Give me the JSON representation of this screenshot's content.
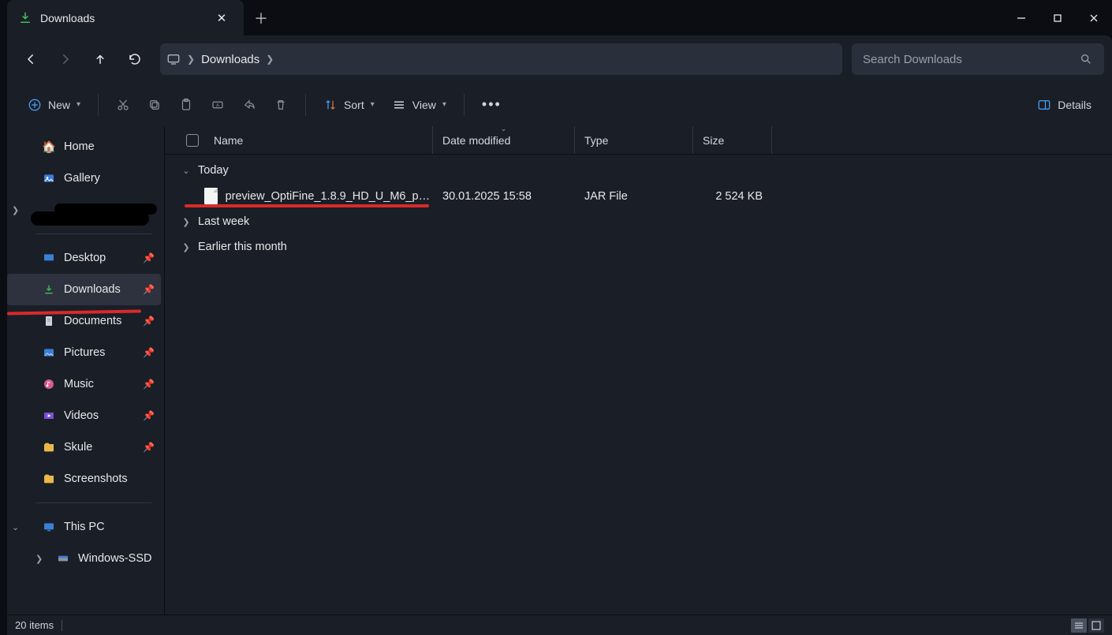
{
  "tab": {
    "title": "Downloads"
  },
  "breadcrumb": {
    "current": "Downloads"
  },
  "search": {
    "placeholder": "Search Downloads"
  },
  "toolbar": {
    "new_label": "New",
    "sort_label": "Sort",
    "view_label": "View",
    "details_label": "Details"
  },
  "sidebar": {
    "home": "Home",
    "gallery": "Gallery",
    "desktop": "Desktop",
    "downloads": "Downloads",
    "documents": "Documents",
    "pictures": "Pictures",
    "music": "Music",
    "videos": "Videos",
    "skule": "Skule",
    "screenshots": "Screenshots",
    "this_pc": "This PC",
    "drive": "Windows-SSD"
  },
  "columns": {
    "name": "Name",
    "date": "Date modified",
    "type": "Type",
    "size": "Size"
  },
  "groups": {
    "today": "Today",
    "last_week": "Last week",
    "earlier_month": "Earlier this month"
  },
  "files": [
    {
      "name": "preview_OptiFine_1.8.9_HD_U_M6_pre...",
      "date": "30.01.2025 15:58",
      "type": "JAR File",
      "size": "2 524 KB"
    }
  ],
  "status": {
    "count": "20 items"
  }
}
